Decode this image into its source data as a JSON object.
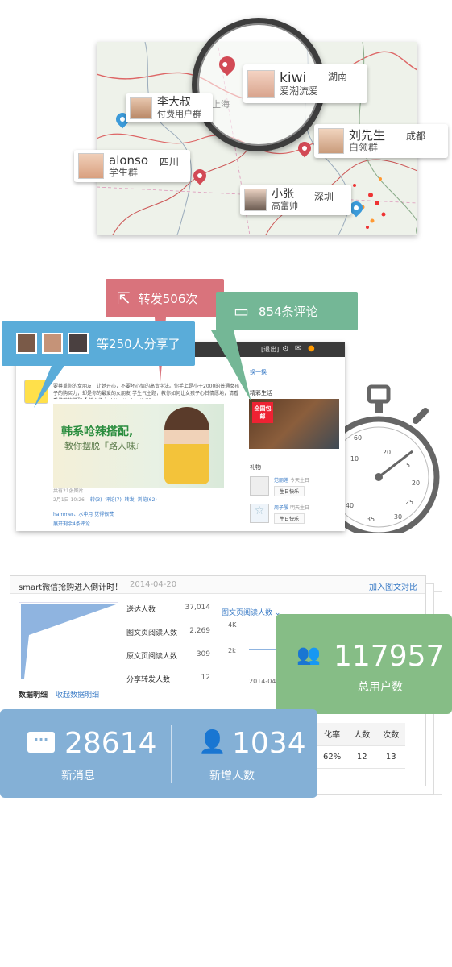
{
  "map": {
    "users": [
      {
        "name": "kiwi",
        "group": "爱潮流爱",
        "city": "湖南"
      },
      {
        "name": "李大叔",
        "group": "付费用户群",
        "city": "上海"
      },
      {
        "name": "刘先生",
        "group": "白领群",
        "city": "成都"
      },
      {
        "name": "alonso",
        "group": "学生群",
        "city": "四川"
      },
      {
        "name": "小张",
        "group": "高富帅",
        "city": "深圳"
      }
    ]
  },
  "share": {
    "forward_label": "转发506次",
    "comment_label": "854条评论",
    "share_label": "等250人分享了",
    "post": {
      "headline": "韩系呛辣搭配,",
      "subline": "教你摆脱『路人味』",
      "text_line1": "要尊重你的女朋友，让她开心，不要坏心情的高贵字法。你手上是小于2000的普通女孩子的购买力，却是你的最爱的女朋友",
      "text_line2": "学生气主题，教你如何让女孩子心甘情愿地，请看看推荐的搭配【 转心缘 】 http://url.cn/84j3",
      "meta": "共有21张图片",
      "time": "2月1日 10:26",
      "actions": "转(3)  评论(7)  转发  浏览(62)",
      "likes": "hammer、水中月 觉得很赞",
      "expand": "展开剩余4条评论",
      "side_link": "换一换",
      "side_title": "精彩生活",
      "promo": "全国包邮",
      "gift_title": "礼物",
      "gift1_user": "范丽莲",
      "gift1_note": "今天生日",
      "gift1_btn": "生日快乐",
      "gift2_user": "周子殷",
      "gift2_note": "明天生日",
      "gift2_btn": "生日快乐",
      "topbar": "[退出]"
    }
  },
  "stats": {
    "panel_title": "smart微信抢购进入倒计时！",
    "panel_date": "2014-04-20",
    "panel_link": "加入图文对比",
    "funnel": [
      {
        "label": "送达人数",
        "value": "37,014"
      },
      {
        "label": "图文页阅读人数",
        "value": "2,269"
      },
      {
        "label": "原文页阅读人数",
        "value": "309"
      },
      {
        "label": "分享转发人数",
        "value": "12"
      }
    ],
    "chart_select": "图文页阅读人数",
    "axis_4k": "4K",
    "axis_2k": "2k",
    "axis_date": "2014-04",
    "detail_label": "数据明细",
    "detail_link": "收起数据明细",
    "table_headers": [
      "化率",
      "人数",
      "次数"
    ],
    "table_row": [
      "62%",
      "12",
      "13"
    ],
    "total_users": {
      "value": "117957",
      "label": "总用户数"
    },
    "new_messages": {
      "value": "28614",
      "label": "新消息"
    },
    "new_users": {
      "value": "1034",
      "label": "新增人数"
    }
  },
  "colors": {
    "pin_red": "#d24a55",
    "pin_blue": "#3b9ad9",
    "bubble_red": "#d9737c",
    "bubble_green": "#74b796",
    "bubble_blue": "#5aacd9",
    "stat_green": "#86bd86",
    "stat_blue": "#84b0d6",
    "link_blue": "#3a7bc6"
  }
}
